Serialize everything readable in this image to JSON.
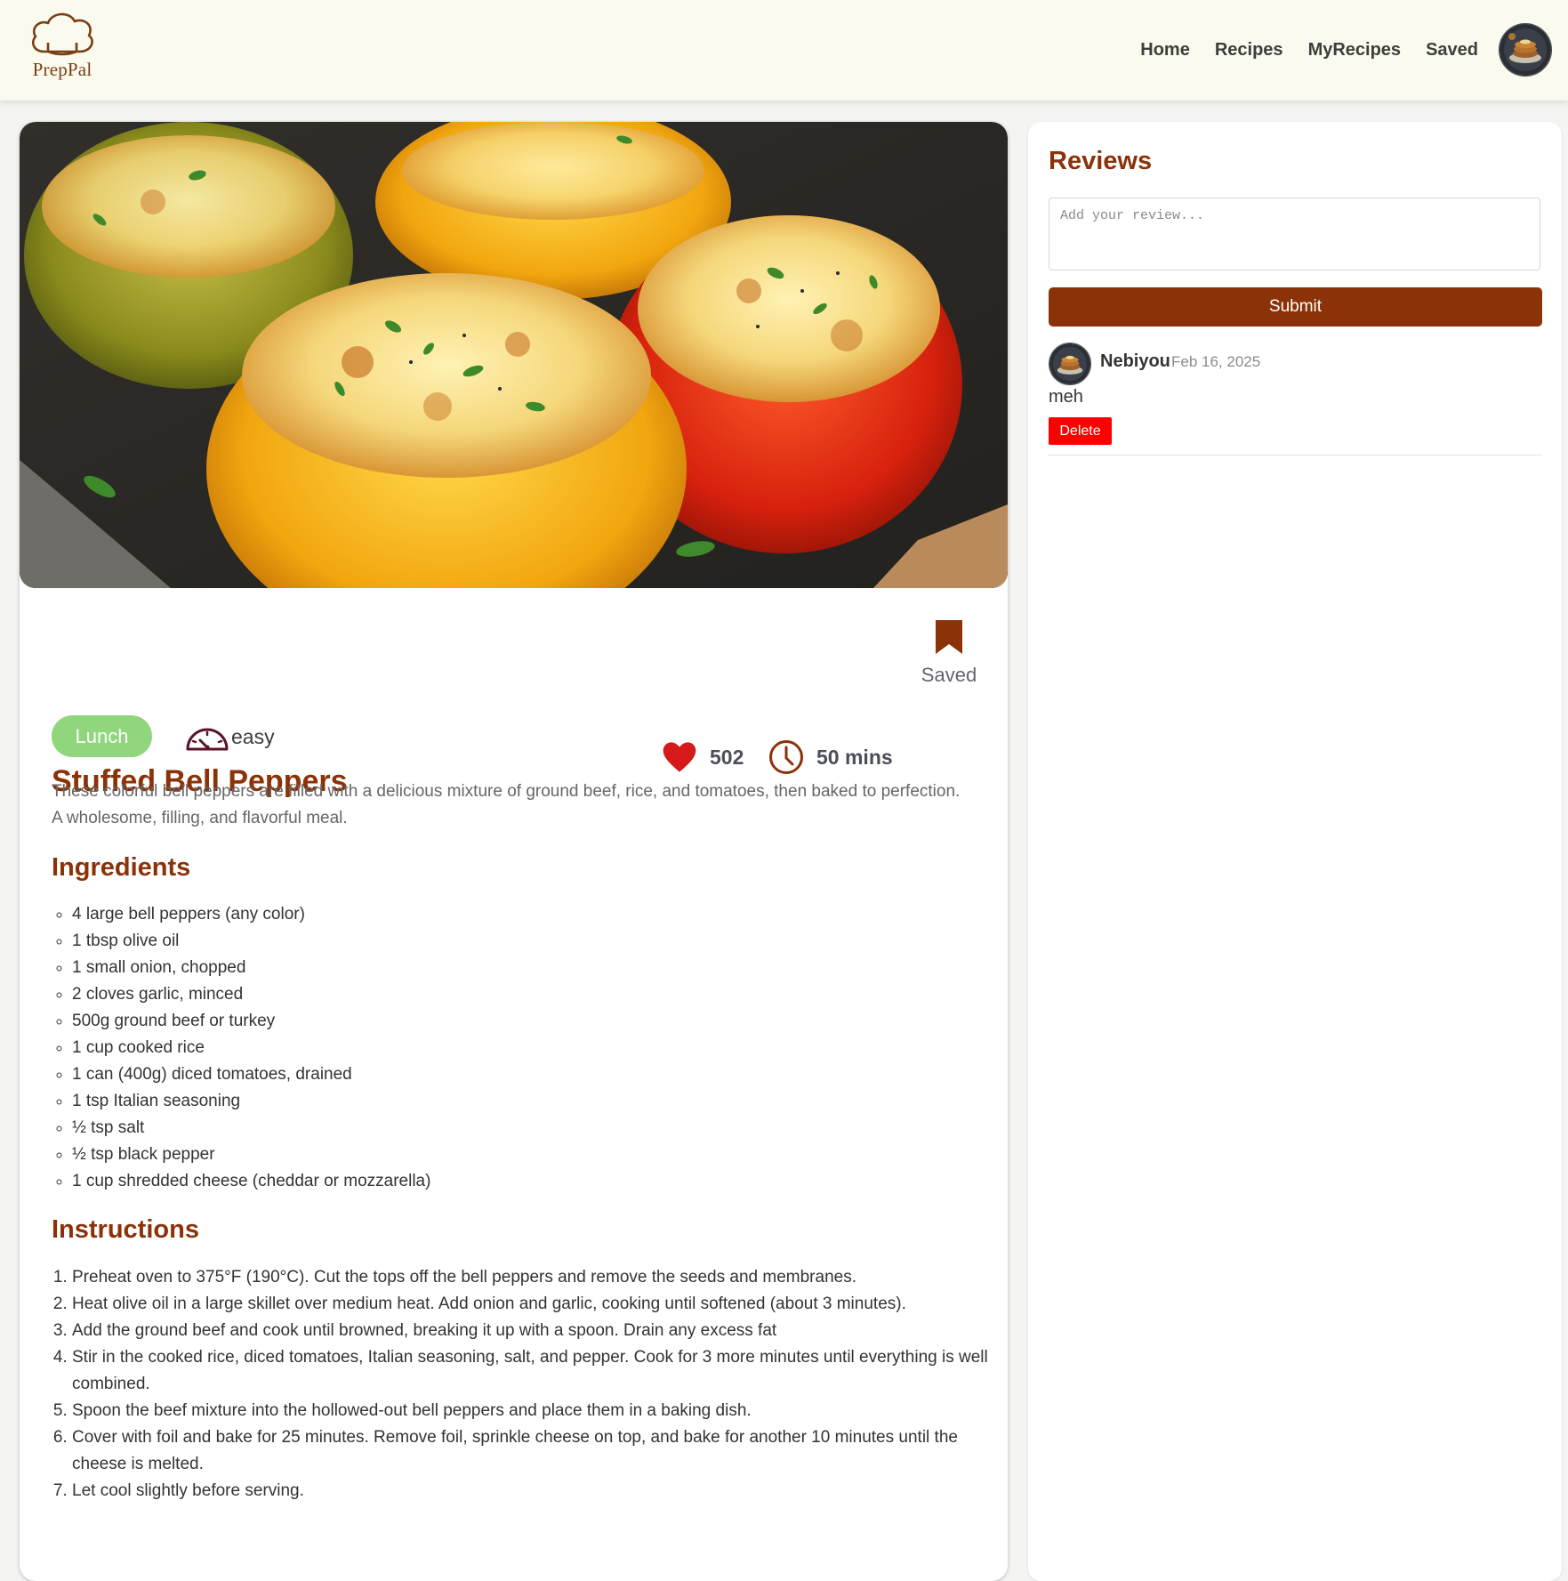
{
  "app": {
    "brand": "PrepPal"
  },
  "nav": {
    "items": [
      "Home",
      "Recipes",
      "MyRecipes",
      "Saved"
    ]
  },
  "recipe": {
    "title": "Stuffed Bell Peppers",
    "likes": "502",
    "time": "50 mins",
    "saved_label": "Saved",
    "category": "Lunch",
    "difficulty": "easy",
    "description": "These colorful bell peppers are filled with a delicious mixture of ground beef, rice, and tomatoes, then baked to perfection. A wholesome, filling, and flavorful meal.",
    "ingredients_heading": "Ingredients",
    "ingredients": [
      "4 large bell peppers (any color)",
      "1 tbsp olive oil",
      "1 small onion, chopped",
      "2 cloves garlic, minced",
      "500g ground beef or turkey",
      "1 cup cooked rice",
      "1 can (400g) diced tomatoes, drained",
      "1 tsp Italian seasoning",
      "½ tsp salt",
      "½ tsp black pepper",
      "1 cup shredded cheese (cheddar or mozzarella)"
    ],
    "instructions_heading": "Instructions",
    "instructions": [
      "Preheat oven to 375°F (190°C). Cut the tops off the bell peppers and remove the seeds and membranes.",
      "Heat olive oil in a large skillet over medium heat. Add onion and garlic, cooking until softened (about 3 minutes).",
      "Add the ground beef and cook until browned, breaking it up with a spoon. Drain any excess fat",
      "Stir in the cooked rice, diced tomatoes, Italian seasoning, salt, and pepper. Cook for 3 more minutes until everything is well combined.",
      "Spoon the beef mixture into the hollowed-out bell peppers and place them in a baking dish.",
      "Cover with foil and bake for 25 minutes. Remove foil, sprinkle cheese on top, and bake for another 10 minutes until the cheese is melted.",
      "Let cool slightly before serving."
    ]
  },
  "reviews": {
    "title": "Reviews",
    "placeholder": "Add your review...",
    "submit_label": "Submit",
    "items": [
      {
        "author": "Nebiyou",
        "date": "Feb 16, 2025",
        "text": "meh",
        "delete_label": "Delete"
      }
    ]
  },
  "colors": {
    "brand": "#8b3208",
    "header_bg": "#fafaee",
    "pill": "#8fd67c",
    "like": "#d51a1a",
    "delete": "#ff0000"
  },
  "icons": [
    "chef-hat-icon",
    "heart-icon",
    "clock-icon",
    "bookmark-icon",
    "gauge-icon"
  ]
}
